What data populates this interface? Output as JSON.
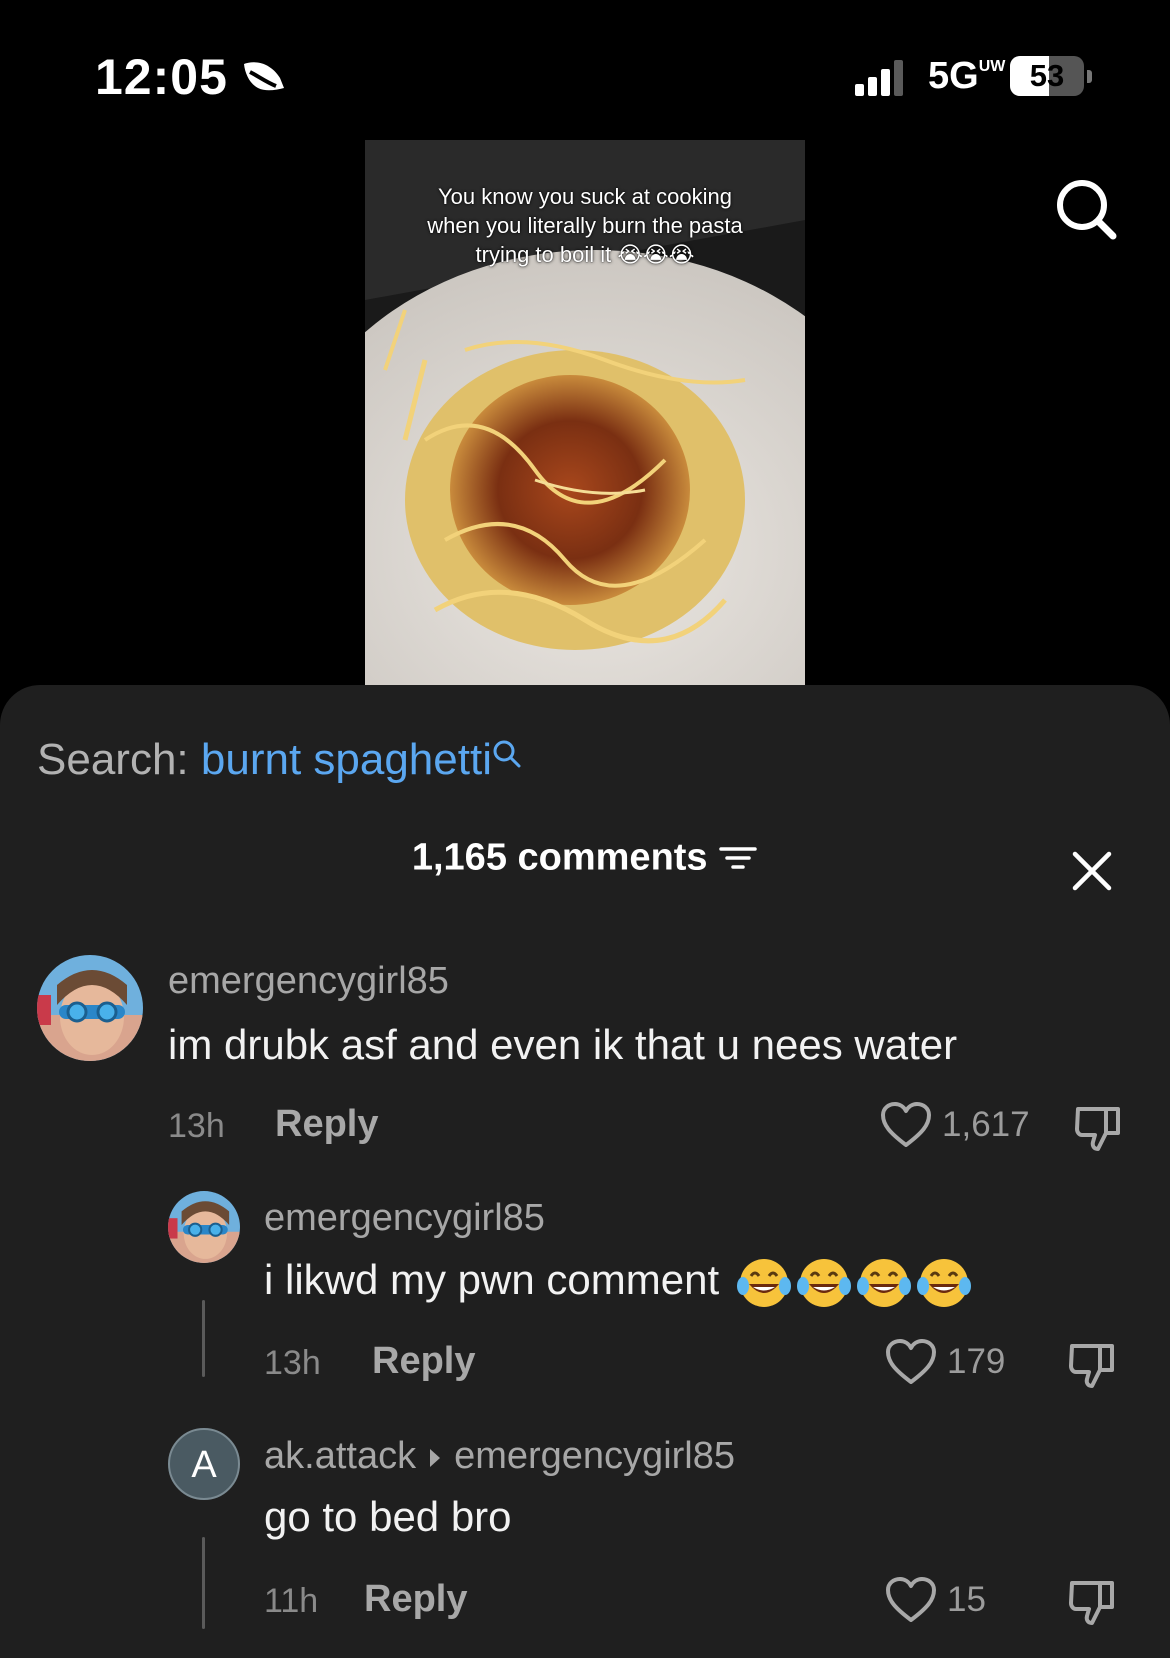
{
  "status_bar": {
    "time": "12:05",
    "network": "5G",
    "network_sub": "UW",
    "battery": "53",
    "battery_fraction": 0.53,
    "icons": [
      "sleep-focus-icon",
      "signal-icon"
    ]
  },
  "video": {
    "caption": "You know you suck at cooking when you literally burn the pasta trying to boil it 😭😭😭"
  },
  "sheet": {
    "search_label": "Search:",
    "search_term": "burnt spaghetti",
    "comment_count": "1,165 comments"
  },
  "comments": [
    {
      "username": "emergencygirl85",
      "text": "im drubk asf and even ik that u nees water",
      "time": "13h",
      "reply_label": "Reply",
      "likes": "1,617"
    },
    {
      "username": "emergencygirl85",
      "text": "i likwd my pwn comment",
      "emoji_count": 4,
      "time": "13h",
      "reply_label": "Reply",
      "likes": "179"
    },
    {
      "username": "ak.attack",
      "reply_to": "emergencygirl85",
      "avatar_initial": "A",
      "text": "go to bed bro",
      "time": "11h",
      "reply_label": "Reply",
      "likes": "15"
    }
  ],
  "colors": {
    "sheet_bg": "#1f1f1f",
    "link_blue": "#5ba7f0",
    "muted_text": "#a7a7a7"
  }
}
